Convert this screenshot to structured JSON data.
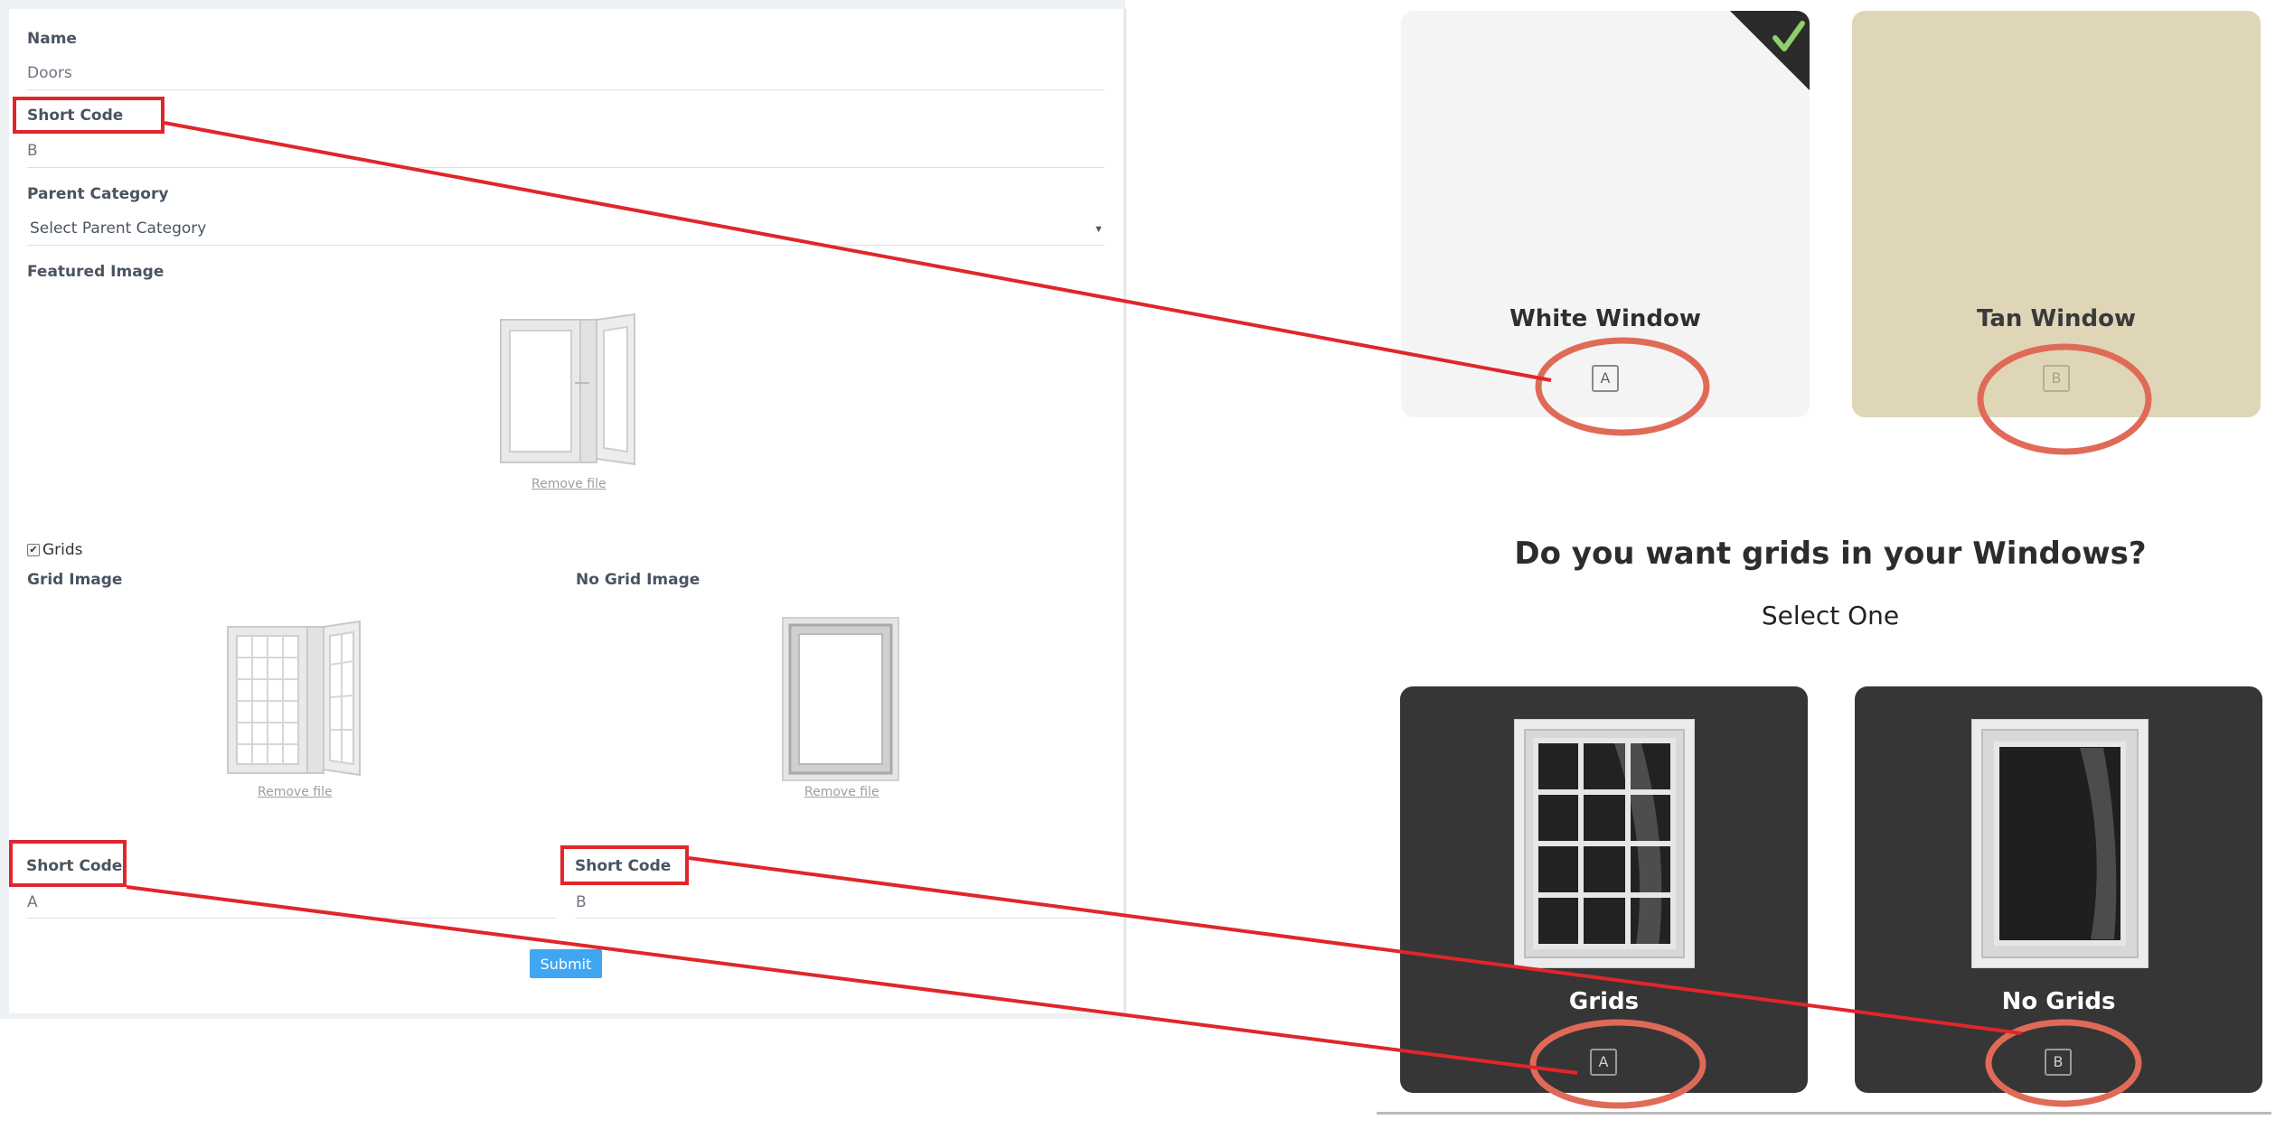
{
  "form": {
    "name_label": "Name",
    "name_value": "Doors",
    "short_code_label": "Short Code",
    "short_code_value": "B",
    "parent_category_label": "Parent Category",
    "parent_category_value": "Select Parent Category",
    "featured_image_label": "Featured Image",
    "remove_file": "Remove file",
    "grids_checkbox_label": "Grids",
    "grids_checked": true,
    "grid_image_label": "Grid Image",
    "no_grid_image_label": "No Grid Image",
    "grid_short_code_label": "Short Code",
    "grid_short_code_value": "A",
    "no_grid_short_code_label": "Short Code",
    "no_grid_short_code_value": "B",
    "submit_label": "Submit"
  },
  "preview": {
    "color_options": [
      {
        "title": "White Window",
        "code": "A",
        "selected": true,
        "bg": "#f4f4f4"
      },
      {
        "title": "Tan Window",
        "code": "B",
        "selected": false,
        "bg": "#ded6b6"
      }
    ],
    "question": "Do you want grids in your Windows?",
    "subtitle": "Select One",
    "grid_options": [
      {
        "title": "Grids",
        "code": "A",
        "bg": "#363636"
      },
      {
        "title": "No Grids",
        "code": "B",
        "bg": "#363636"
      }
    ]
  },
  "annotation_color": "#e0262b",
  "ellipse_color": "#e06a58",
  "accent": "#41a6f1"
}
